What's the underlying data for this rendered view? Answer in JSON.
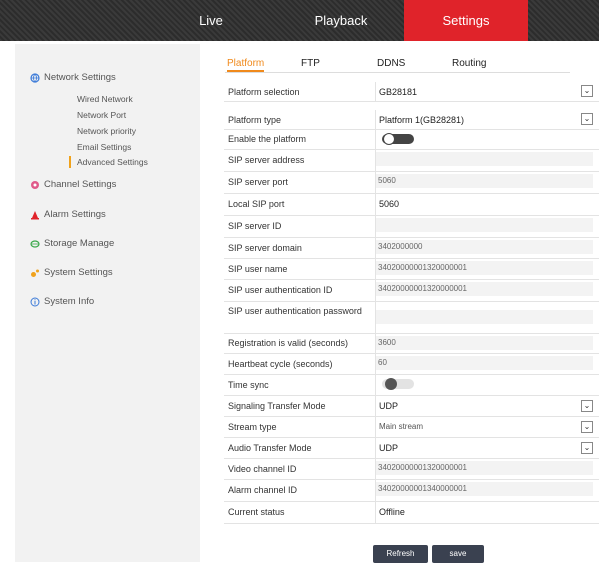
{
  "topbar": {
    "live": "Live",
    "playback": "Playback",
    "settings": "Settings"
  },
  "sidebar": {
    "network": "Network Settings",
    "network_items": [
      "Wired Network",
      "Network Port",
      "Network priority",
      "Email Settings",
      "Advanced Settings"
    ],
    "channel": "Channel Settings",
    "alarm": "Alarm Settings",
    "storage": "Storage Manage",
    "system": "System Settings",
    "info": "System Info"
  },
  "subtabs": {
    "platform": "Platform",
    "ftp": "FTP",
    "ddns": "DDNS",
    "routing": "Routing"
  },
  "form": {
    "platform_selection": {
      "label": "Platform selection",
      "value": "GB28181"
    },
    "platform_type": {
      "label": "Platform type",
      "value": "Platform 1(GB28281)"
    },
    "enable_platform": {
      "label": "Enable the platform"
    },
    "sip_server_address": {
      "label": "SIP server address",
      "value": ""
    },
    "sip_server_port": {
      "label": "SIP server port",
      "value": "5060"
    },
    "local_sip_port": {
      "label": "Local SIP port",
      "value": "5060"
    },
    "sip_server_id": {
      "label": "SIP server ID",
      "value": ""
    },
    "sip_server_domain": {
      "label": "SIP server domain",
      "value": "3402000000"
    },
    "sip_user_name": {
      "label": "SIP user name",
      "value": "34020000001320000001"
    },
    "sip_user_auth_id": {
      "label": "SIP user authentication ID",
      "value": "34020000001320000001"
    },
    "sip_user_auth_password": {
      "label": "SIP user authentication password",
      "value": ""
    },
    "registration_valid": {
      "label": "Registration is valid (seconds)",
      "value": "3600"
    },
    "heartbeat_cycle": {
      "label": "Heartbeat cycle (seconds)",
      "value": "60"
    },
    "time_sync": {
      "label": "Time sync"
    },
    "signaling_transfer_mode": {
      "label": "Signaling Transfer Mode",
      "value": "UDP"
    },
    "stream_type": {
      "label": "Stream type",
      "value": "Main stream"
    },
    "audio_transfer_mode": {
      "label": "Audio Transfer Mode",
      "value": "UDP"
    },
    "video_channel_id": {
      "label": "Video channel ID",
      "value": "34020000001320000001"
    },
    "alarm_channel_id": {
      "label": "Alarm channel ID",
      "value": "34020000001340000001"
    },
    "current_status": {
      "label": "Current status",
      "value": "Offline"
    }
  },
  "buttons": {
    "refresh": "Refresh",
    "save": "save"
  },
  "colors": {
    "accent": "#e0232a",
    "tab_active": "#f08a1c",
    "button": "#3a4150"
  }
}
